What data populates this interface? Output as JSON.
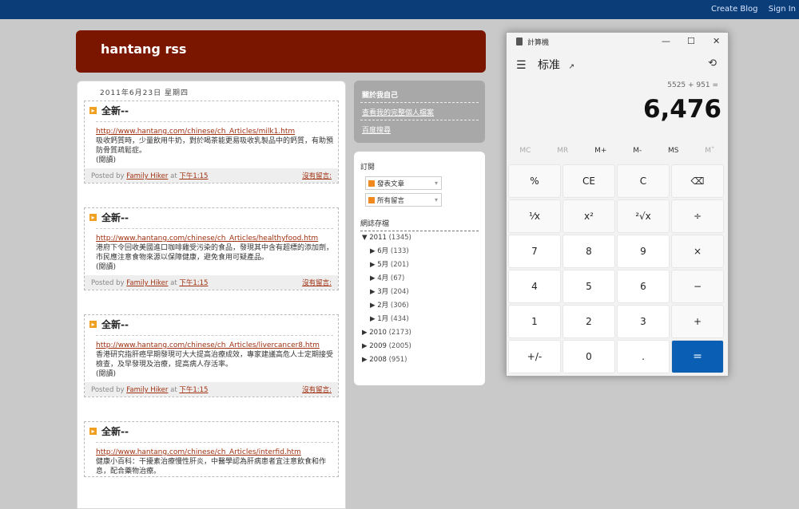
{
  "navbar": {
    "create_blog": "Create Blog",
    "sign_in": "Sign In"
  },
  "blog": {
    "title": "hantang rss"
  },
  "posts": {
    "date": "2011年6月23日 星期四",
    "items": [
      {
        "title": "全新--",
        "url": "http://www.hantang.com/chinese/ch_Articles/milk1.htm",
        "body": "吸收鈣質時，少量飲用牛奶，對於喝茶能更易吸收乳製品中的鈣質，有助預防骨質疏鬆症。",
        "more": "(閱讀)",
        "posted_by": "Posted by",
        "author": "Family Hiker",
        "at": "at",
        "time": "下午1:15",
        "comments": "沒有留言:"
      },
      {
        "title": "全新--",
        "url": "http://www.hantang.com/chinese/ch_Articles/healthyfood.htm",
        "body": "港府下令回收美國進口咖啡雞受污染的食品，發現其中含有超標的添加劑，市民應注意食物來源以保障健康，避免食用可疑產品。",
        "more": "(閱讀)",
        "posted_by": "Posted by",
        "author": "Family Hiker",
        "at": "at",
        "time": "下午1:15",
        "comments": "沒有留言:"
      },
      {
        "title": "全新--",
        "url": "http://www.hantang.com/chinese/ch_Articles/livercancer8.htm",
        "body": "香港研究指肝癌早期發現可大大提高治療成效，專家建議高危人士定期接受檢查，及早發現及治療，提高病人存活率。",
        "more": "(閱讀)",
        "posted_by": "Posted by",
        "author": "Family Hiker",
        "at": "at",
        "time": "下午1:15",
        "comments": "沒有留言:"
      },
      {
        "title": "全新--",
        "url": "http://www.hantang.com/chinese/ch_Articles/interfid.htm",
        "body": "健康小百科：干擾素治療慢性肝炎，中醫學認為肝病患者宜注意飲食和作息，配合藥物治療。",
        "more": "",
        "posted_by": "",
        "author": "",
        "at": "",
        "time": "",
        "comments": ""
      }
    ]
  },
  "sidebar": {
    "about": {
      "header": "關於我自己",
      "items": [
        "查看我的完整個人檔案",
        "百度搜尋"
      ]
    },
    "subscribe": {
      "header": "訂閱",
      "feeds": [
        "發表文章",
        "所有留言"
      ]
    },
    "archive": {
      "header": "網誌存檔",
      "years": [
        {
          "label": "2011",
          "count": "(1345)",
          "open": true,
          "months": [
            {
              "label": "6月",
              "count": "(133)"
            },
            {
              "label": "5月",
              "count": "(201)"
            },
            {
              "label": "4月",
              "count": "(67)"
            },
            {
              "label": "3月",
              "count": "(204)"
            },
            {
              "label": "2月",
              "count": "(306)"
            },
            {
              "label": "1月",
              "count": "(434)"
            }
          ]
        },
        {
          "label": "2010",
          "count": "(2173)",
          "open": false,
          "months": []
        },
        {
          "label": "2009",
          "count": "(2005)",
          "open": false,
          "months": []
        },
        {
          "label": "2008",
          "count": "(951)",
          "open": false,
          "months": []
        }
      ]
    }
  },
  "calculator": {
    "app_title": "計算機",
    "mode": "标准",
    "expression": "5525 + 951 =",
    "display": "6,476",
    "memory": [
      "MC",
      "MR",
      "M+",
      "M-",
      "MS",
      "M˅"
    ],
    "memory_enabled": [
      false,
      false,
      true,
      true,
      true,
      false
    ],
    "keys": [
      "%",
      "CE",
      "C",
      "⌫",
      "⅟x",
      "x²",
      "²√x",
      "÷",
      "7",
      "8",
      "9",
      "×",
      "4",
      "5",
      "6",
      "−",
      "1",
      "2",
      "3",
      "+",
      "+/-",
      "0",
      ".",
      "="
    ],
    "colors": {
      "equals": "#0a5fb4"
    }
  }
}
